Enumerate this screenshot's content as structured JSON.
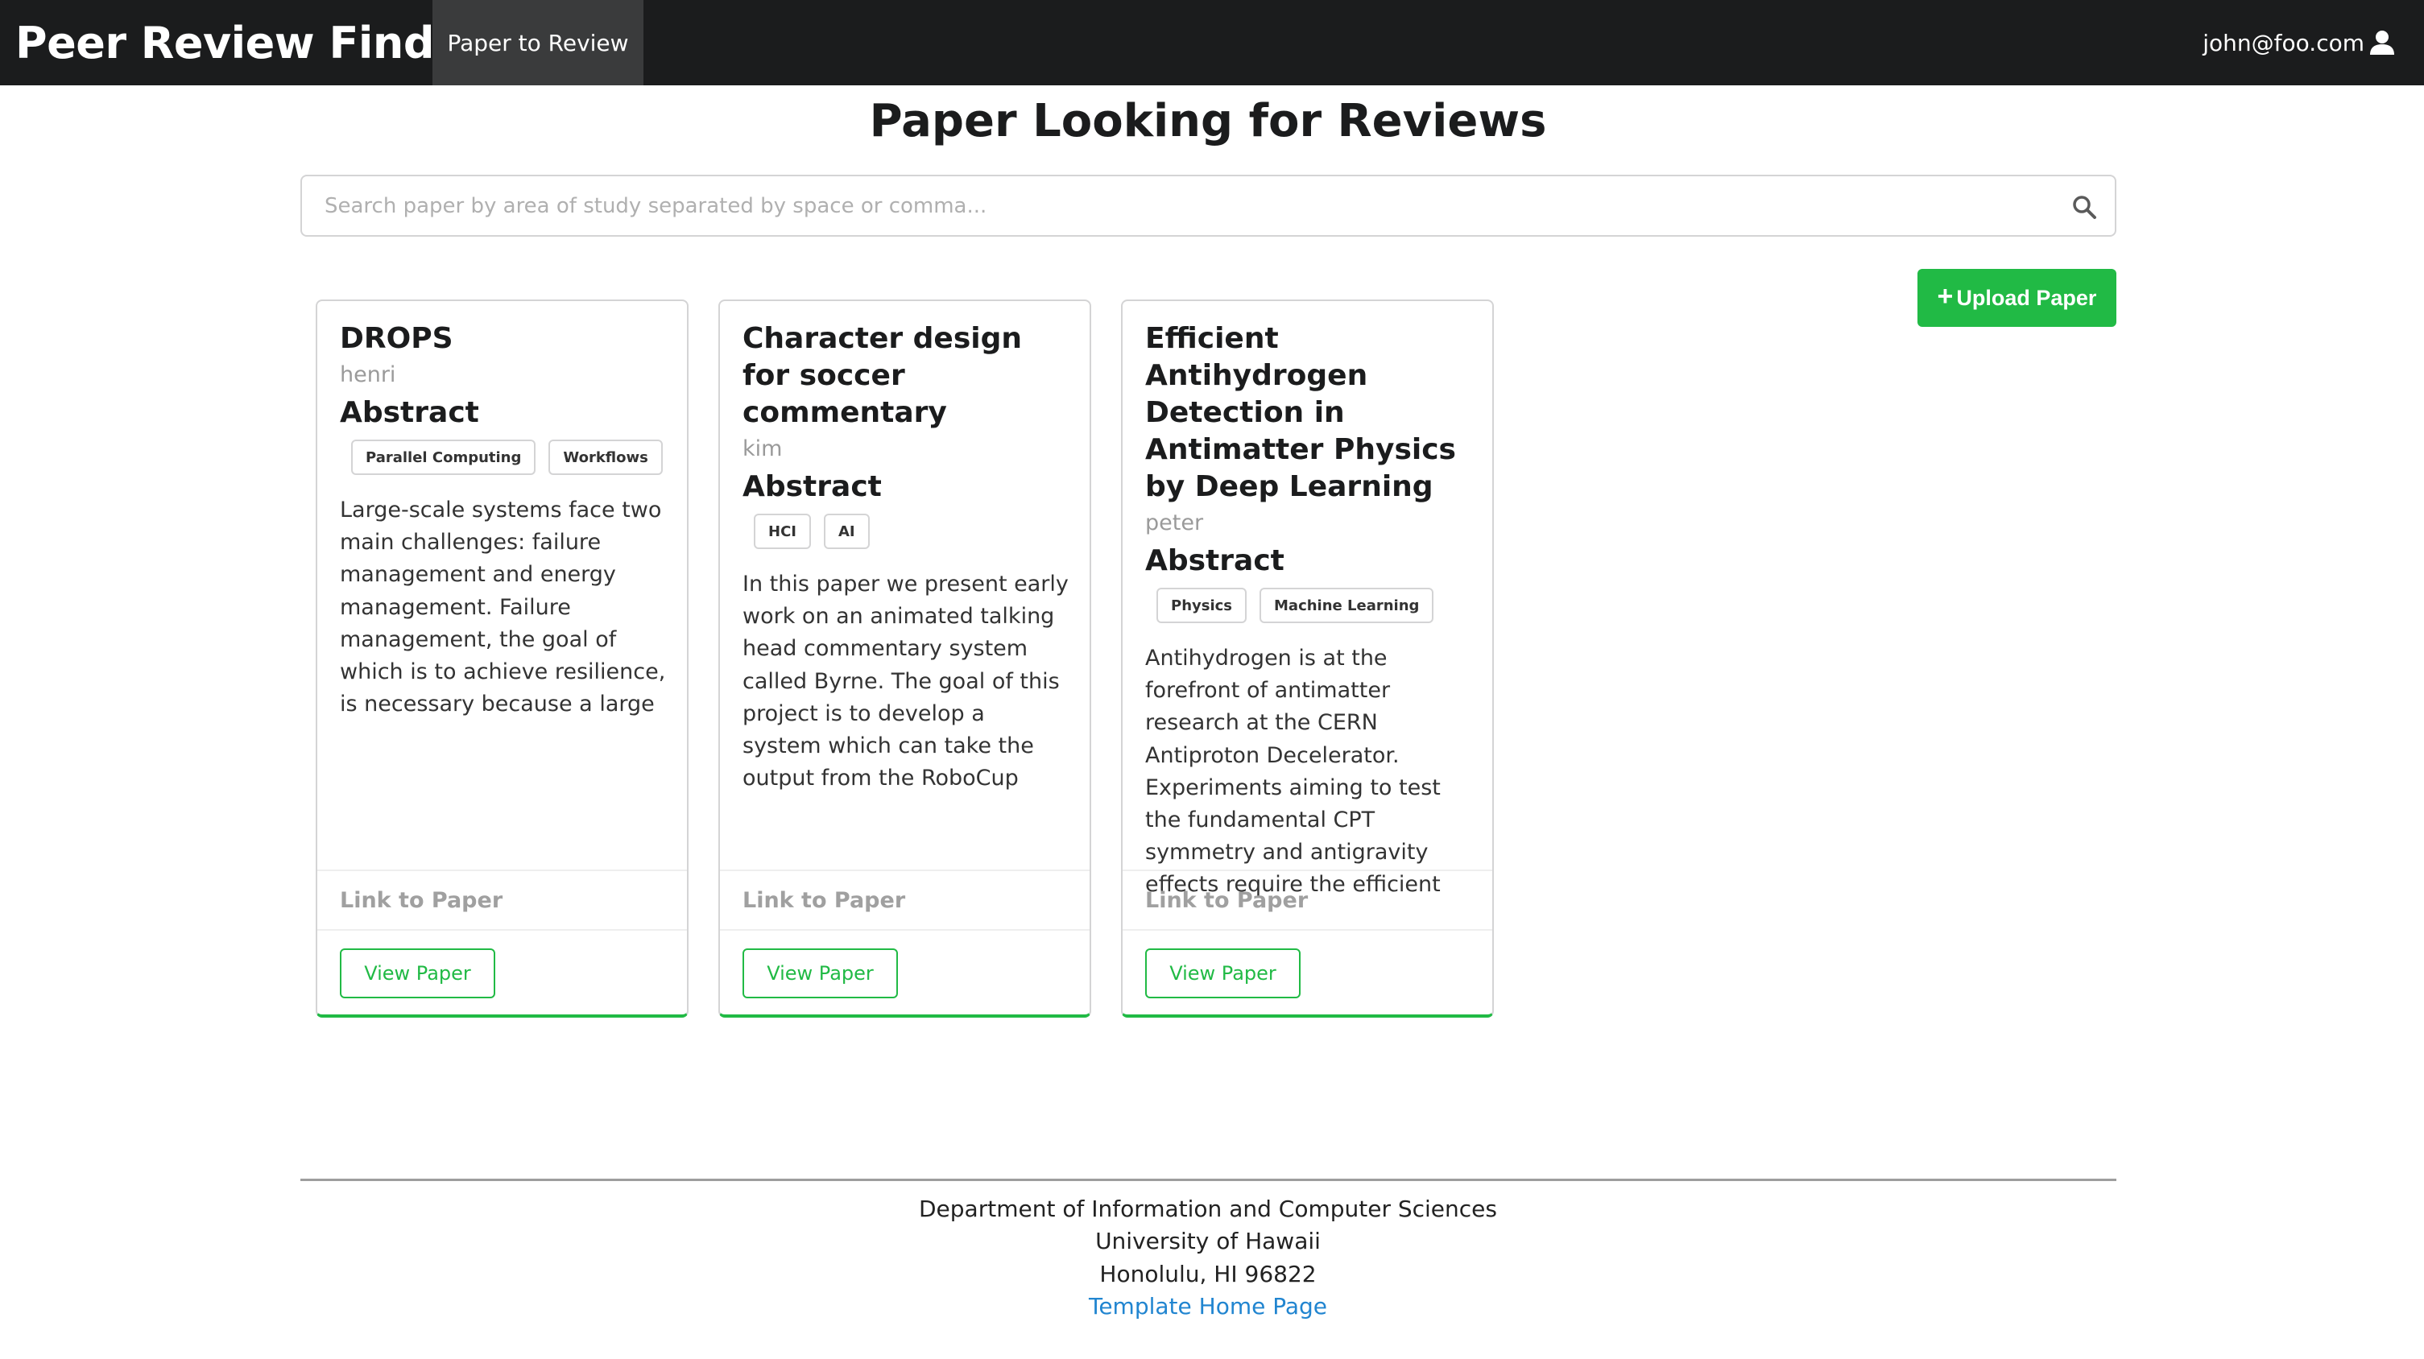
{
  "navbar": {
    "brand": "Peer Review Finder",
    "item": "Paper to Review",
    "user": "john@foo.com"
  },
  "page": {
    "title": "Paper Looking for Reviews"
  },
  "search": {
    "placeholder": "Search paper by area of study separated by space or comma...",
    "value": ""
  },
  "upload": {
    "label": "Upload Paper"
  },
  "cards": [
    {
      "title": "DROPS",
      "author": "henri",
      "abstract_heading": "Abstract",
      "tags": [
        "Parallel Computing",
        "Workflows"
      ],
      "abstract": "Large-scale systems face two main challenges: failure management and energy management. Failure management, the goal of which is to achieve resilience, is necessary because a large number of hardware resources",
      "link_label": "Link to Paper",
      "button": "View Paper"
    },
    {
      "title": "Character design for soccer commentary",
      "author": "kim",
      "abstract_heading": "Abstract",
      "tags": [
        "HCI",
        "AI"
      ],
      "abstract": "In this paper we present early work on an animated talking head commentary system called Byrne. The goal of this project is to develop a system which can take the output from the RoboCup soccer simulator, and generate appropriate affective",
      "link_label": "Link to Paper",
      "button": "View Paper"
    },
    {
      "title": "Efficient Antihydrogen Detection in Antimatter Physics by Deep Learning",
      "author": "peter",
      "abstract_heading": "Abstract",
      "tags": [
        "Physics",
        "Machine Learning"
      ],
      "abstract": "Antihydrogen is at the forefront of antimatter research at the CERN Antiproton Decelerator. Experiments aiming to test the fundamental CPT symmetry and antigravity effects require the efficient detection of antihydrogen annihilation",
      "link_label": "Link to Paper",
      "button": "View Paper"
    }
  ],
  "footer": {
    "line1": "Department of Information and Computer Sciences",
    "line2": "University of Hawaii",
    "line3": "Honolulu, HI 96822",
    "link": "Template Home Page"
  },
  "colors": {
    "navbar": "#1b1c1d",
    "accent": "#21ba45",
    "link": "#2185d0"
  }
}
